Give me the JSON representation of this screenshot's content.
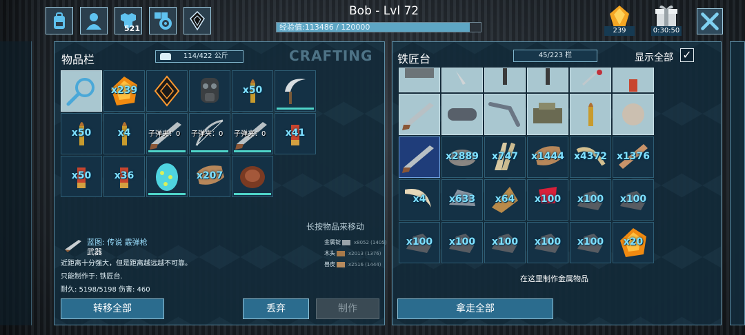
{
  "header": {
    "player_name": "Bob - Lvl 72",
    "xp_label": "经验值:113486 / 120000",
    "xp_fraction": 0.946,
    "tribe_badge": "521",
    "gems": "239",
    "gift_timer": "0:30:50"
  },
  "top_icons": [
    "backpack-icon",
    "player-icon",
    "tribe-icon",
    "settings-icon",
    "implant-icon"
  ],
  "inventory": {
    "title": "物品栏",
    "weight": "114/422 公斤",
    "crafting_tab": "CRAFTING",
    "slots": [
      {
        "icon": "search-icon",
        "label": ""
      },
      {
        "icon": "amber-icon",
        "label": "x239"
      },
      {
        "icon": "implant-item-icon",
        "label": ""
      },
      {
        "icon": "gasmask-icon",
        "label": ""
      },
      {
        "icon": "bullet-icon",
        "label": "x50"
      },
      {
        "icon": "sickle-icon",
        "label": ""
      },
      {
        "icon": "bullet-icon",
        "label": "x50"
      },
      {
        "icon": "bullet-icon",
        "label": "x4"
      },
      {
        "icon": "shotgun-icon",
        "label": "子弹夹：0"
      },
      {
        "icon": "bow-icon",
        "label": "子弹夹：0"
      },
      {
        "icon": "shotgun-icon",
        "label": "子弹夹：0"
      },
      {
        "icon": "shell-icon",
        "label": "x41"
      },
      {
        "icon": "shell-icon",
        "label": "x50"
      },
      {
        "icon": "shell-icon",
        "label": "x36"
      },
      {
        "icon": "egg-icon",
        "label": ""
      },
      {
        "icon": "hide-icon",
        "label": "x207"
      },
      {
        "icon": "meat-icon",
        "label": ""
      }
    ],
    "hint": "长按物品来移动",
    "detail": {
      "name": "蓝图: 传说 霰弹枪",
      "type": "武器",
      "desc": "近距离十分强大，但是距离越远越不可靠。",
      "made_in": "只能制作于: 铁匠台.",
      "stats": "耐久: 5198/5198 伤害: 460"
    },
    "requirements": [
      {
        "name": "金属锭",
        "qty": "x8052 (1405)"
      },
      {
        "name": "木头",
        "qty": "x2013 (1376)"
      },
      {
        "name": "兽皮",
        "qty": "x2516 (1444)"
      }
    ],
    "transfer_all": "转移全部",
    "drop": "丢弃",
    "craft": "制作"
  },
  "smithy": {
    "title": "铁匠台",
    "slot_count": "45/223 栏",
    "show_all": "显示全部",
    "show_all_checked": "✓",
    "slots": [
      {
        "icon": "blueprint-blank-icon",
        "label": ""
      },
      {
        "icon": "knife-icon",
        "label": ""
      },
      {
        "icon": "blueprint-tool-icon",
        "label": ""
      },
      {
        "icon": "blueprint-tool-icon",
        "label": ""
      },
      {
        "icon": "syringe-icon",
        "label": ""
      },
      {
        "icon": "shell-icon",
        "label": ""
      },
      {
        "icon": "shotgun-icon",
        "label": ""
      },
      {
        "icon": "pipe-icon",
        "label": ""
      },
      {
        "icon": "crowbar-icon",
        "label": ""
      },
      {
        "icon": "machine-icon",
        "label": ""
      },
      {
        "icon": "bullet-icon",
        "label": ""
      },
      {
        "icon": "ball-icon",
        "label": ""
      },
      {
        "icon": "shotgun-icon",
        "label": ""
      },
      {
        "icon": "stone-icon",
        "label": "x2889"
      },
      {
        "icon": "thatch-icon",
        "label": "x747"
      },
      {
        "icon": "hide-icon",
        "label": "x1444"
      },
      {
        "icon": "fiber-icon",
        "label": "x4372"
      },
      {
        "icon": "wood-icon",
        "label": "x1376"
      },
      {
        "icon": "tusk-icon",
        "label": "x4"
      },
      {
        "icon": "flint-icon",
        "label": "x633"
      },
      {
        "icon": "chitin-icon",
        "label": "x64"
      },
      {
        "icon": "raw-meat-icon",
        "label": "x100"
      },
      {
        "icon": "ore-icon",
        "label": "x100"
      },
      {
        "icon": "ore-icon",
        "label": "x100"
      },
      {
        "icon": "ore-icon",
        "label": "x100"
      },
      {
        "icon": "ore-icon",
        "label": "x100"
      },
      {
        "icon": "ore-icon",
        "label": "x100"
      },
      {
        "icon": "ore-icon",
        "label": "x100"
      },
      {
        "icon": "ore-icon",
        "label": "x100"
      },
      {
        "icon": "amber-icon",
        "label": "x20"
      }
    ],
    "craft_here": "在这里制作金属物品",
    "take_all": "拿走全部"
  },
  "colors": {
    "panel": "#122a3a",
    "accent": "#2b6c8e",
    "qty_text": "#7fe0ff"
  }
}
